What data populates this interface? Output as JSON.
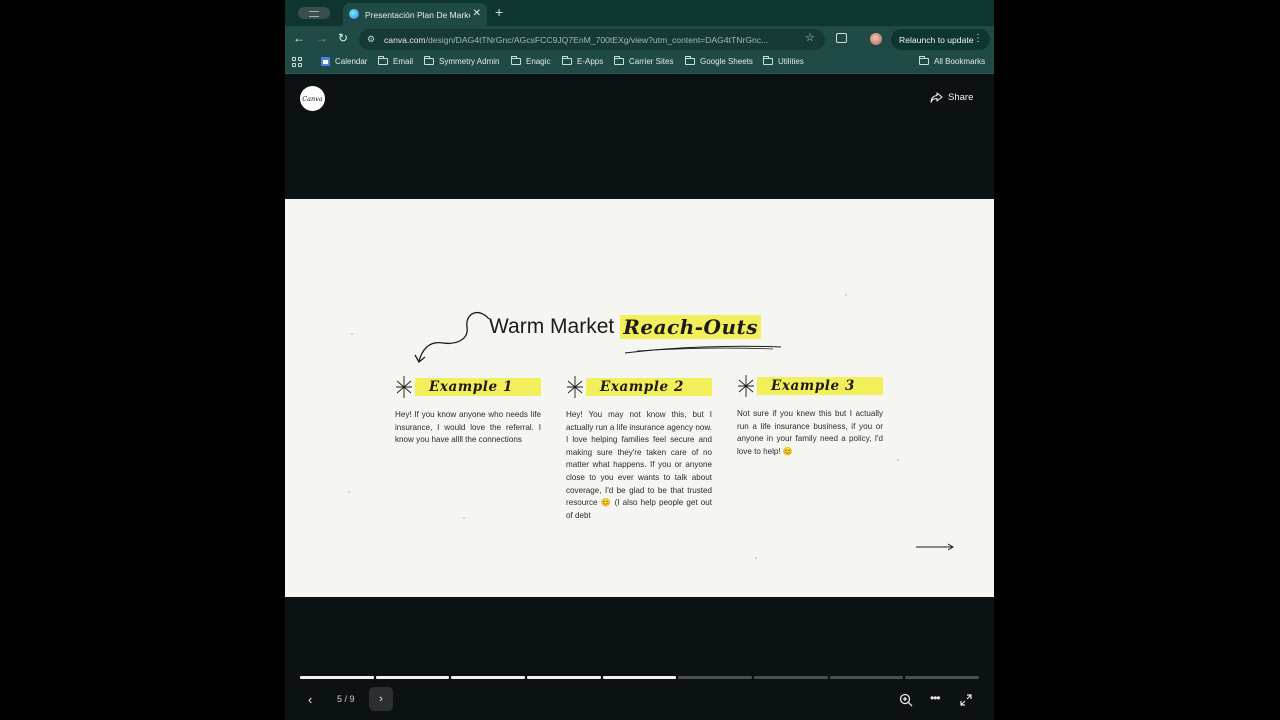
{
  "browser": {
    "tab_title": "Presentación Plan De Marketi",
    "tab_close": "✕",
    "new_tab": "+",
    "url_host": "canva.com",
    "url_path": "/design/DAG4tTNrGnc/AGcsFCC9JQ7EnM_700tEXg/view?utm_content=DAG4tTNrGnc...",
    "relaunch_label": "Relaunch to update",
    "bookmarks": [
      "Calendar",
      "Email",
      "Symmetry Admin",
      "Enagic",
      "E-Apps",
      "Carrier Sites",
      "Google Sheets",
      "Utilities"
    ],
    "all_bookmarks": "All Bookmarks"
  },
  "viewer": {
    "logo_text": "Canva",
    "share_label": "Share",
    "page_indicator": "5 / 9",
    "current_page": 5,
    "total_pages": 9
  },
  "slide": {
    "title_plain": "Warm Market",
    "title_highlight": "Reach-Outs",
    "examples": [
      {
        "label": "Example 1",
        "text": "Hey! If you know anyone who needs life insurance, I would love the referral. I know you have allll the connections"
      },
      {
        "label": "Example 2",
        "text": "Hey! You may not know this, but I actually run a life insurance agency now. I love helping families feel secure and making sure they're taken care of no matter what happens. If you or anyone close to you ever wants to talk about coverage, I'd be glad to be that trusted resource 😊 (I also help people get out of debt"
      },
      {
        "label": "Example 3",
        "text": "Not sure if you knew this but I actually run a life insurance business, if you or anyone in your family need a policy, I'd love to help! 😊"
      }
    ]
  },
  "colors": {
    "chrome": "#1f4a45",
    "tabstrip": "#0f3531",
    "highlight": "#f2ef5a",
    "slide_bg": "#f5f5f1",
    "viewer_bg": "#0c1214"
  }
}
